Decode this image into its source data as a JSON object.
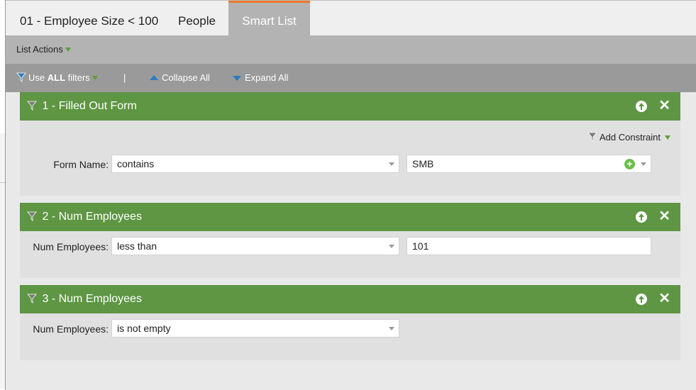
{
  "tabs": [
    {
      "label": "01 - Employee Size < 100"
    },
    {
      "label": "People"
    },
    {
      "label": "Smart List"
    }
  ],
  "active_tab": "Smart List",
  "actions_bar": {
    "list_actions": "List Actions"
  },
  "filter_bar": {
    "use_prefix": "Use ",
    "use_bold": "ALL",
    "use_suffix": " filters",
    "separator": "|",
    "collapse_all": "Collapse All",
    "expand_all": "Expand All"
  },
  "filters": [
    {
      "title": "1 - Filled Out Form",
      "add_constraint": "Add Constraint",
      "field_label": "Form Name:",
      "operator": "contains",
      "value": "SMB"
    },
    {
      "title": "2 - Num Employees",
      "field_label": "Num Employees:",
      "operator": "less than",
      "value": "101"
    },
    {
      "title": "3 - Num Employees",
      "field_label": "Num Employees:",
      "operator": "is not empty"
    }
  ],
  "colors": {
    "header_green": "#5e9643",
    "tab_accent": "#ea7a2e",
    "link_blue": "#2a7bc0"
  }
}
